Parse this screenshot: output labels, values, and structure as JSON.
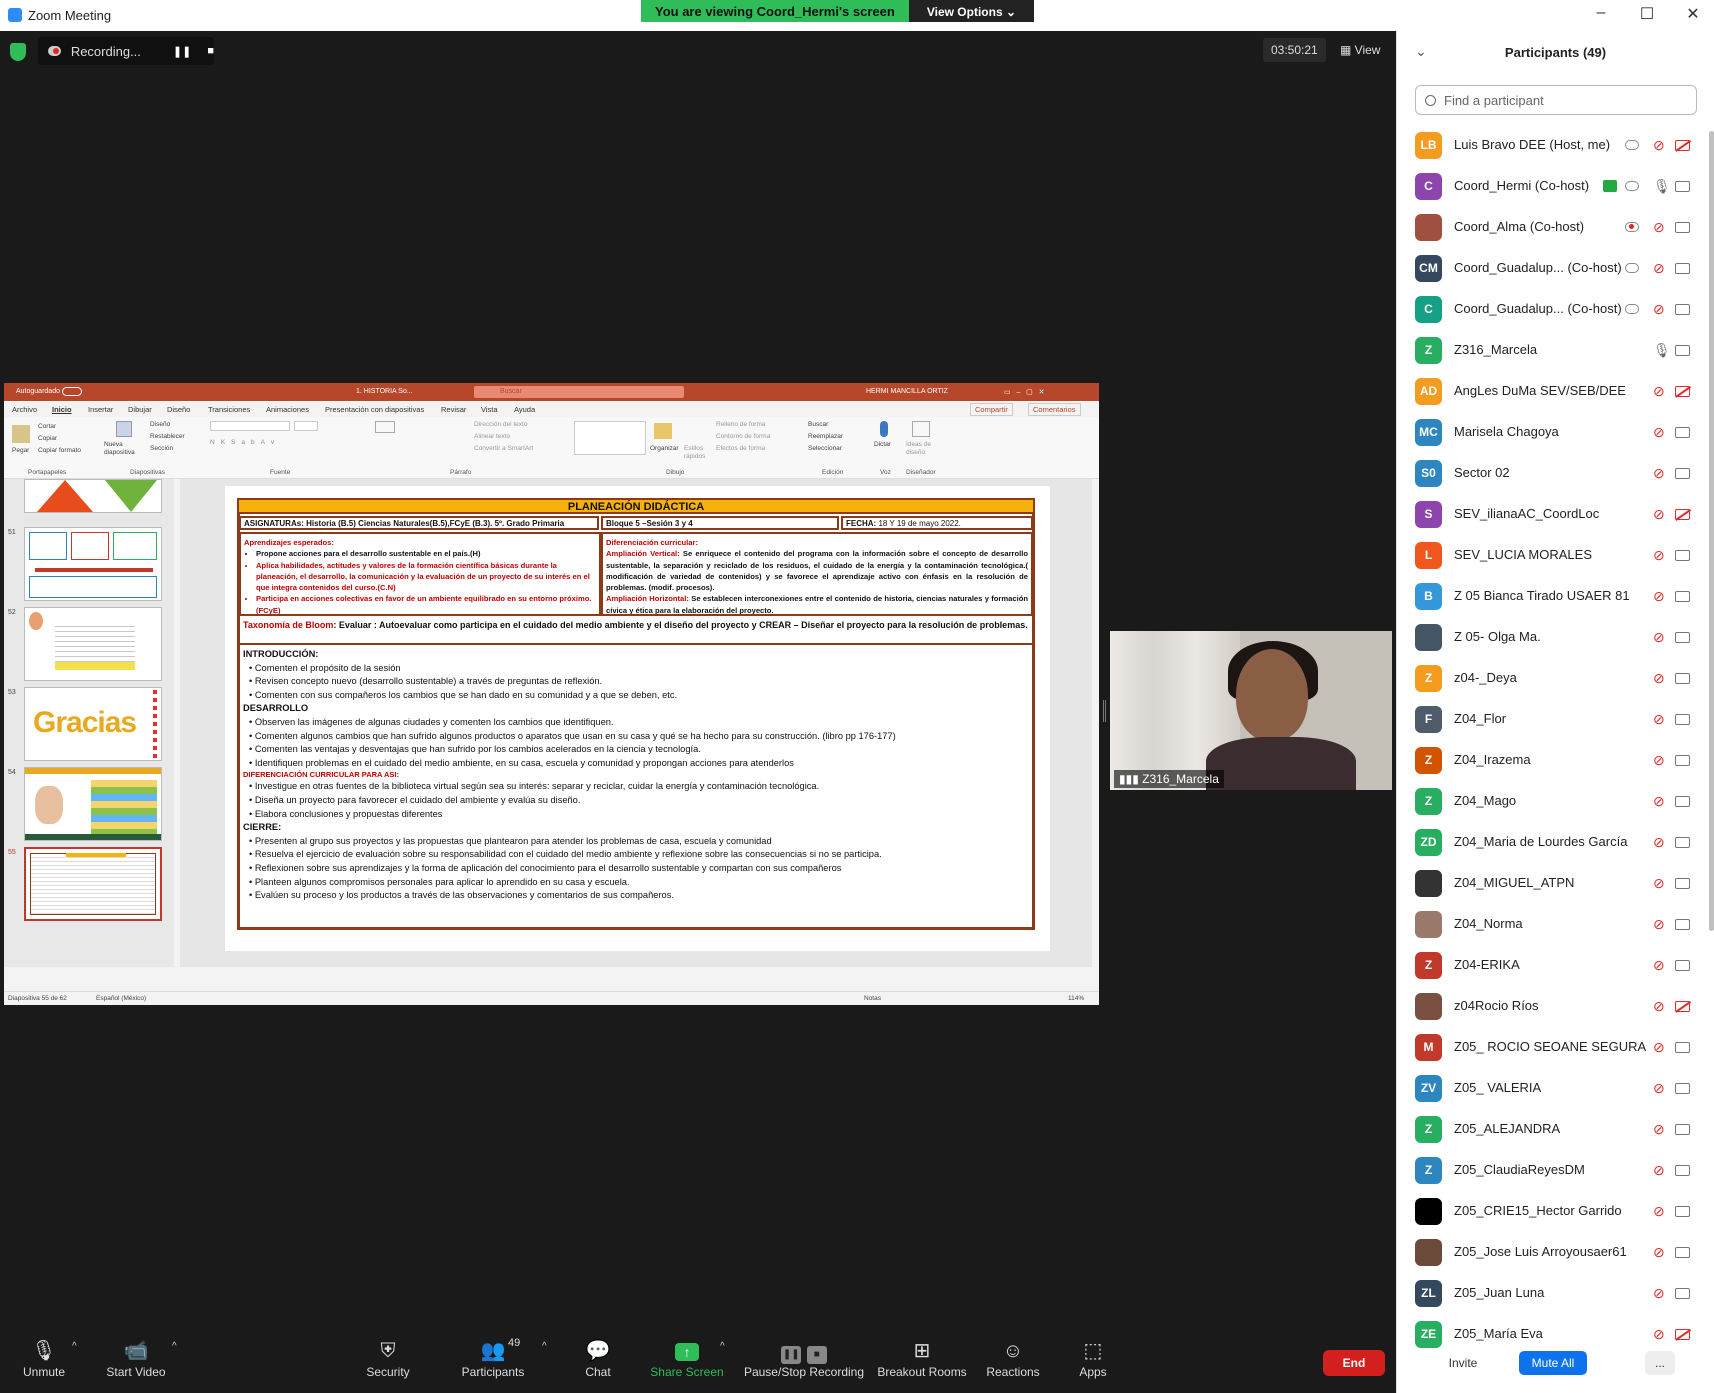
{
  "window": {
    "title": "Zoom Meeting"
  },
  "banner": {
    "viewing": "You are viewing Coord_Hermi's screen",
    "view_options": "View Options ⌄"
  },
  "meeting": {
    "recording_label": "Recording...",
    "timer": "03:50:21",
    "view_label": "View"
  },
  "ppt": {
    "autosave": "Autoguardado",
    "doc_title": "1. HISTORIA So...",
    "search": "Buscar",
    "user": "HERMI MANCILLA ORTIZ",
    "menu": [
      "Archivo",
      "Inicio",
      "Insertar",
      "Dibujar",
      "Diseño",
      "Transiciones",
      "Animaciones",
      "Presentación con diapositivas",
      "Revisar",
      "Vista",
      "Ayuda"
    ],
    "share": "Compartir",
    "comments": "Comentarios",
    "ribbon_groups": [
      "Portapapeles",
      "Diapositivas",
      "Fuente",
      "Párrafo",
      "Dibujo",
      "Edición",
      "Voz",
      "Diseñador"
    ],
    "ribbon_items": {
      "pegar": "Pegar",
      "cortar": "Cortar",
      "copiar": "Copiar",
      "copiar_formato": "Copiar formato",
      "nueva": "Nueva diapositiva",
      "diseno": "Diseño",
      "restablecer": "Restablecer",
      "seccion": "Sección",
      "buscar": "Buscar",
      "reemplazar": "Reemplazar",
      "seleccionar": "Seleccionar",
      "dictar": "Dictar",
      "ideas": "Ideas de diseño",
      "organizar": "Organizar",
      "estilos": "Estilos rápidos",
      "relleno": "Relleno de forma",
      "contorno": "Contorno de forma",
      "efectos": "Efectos de forma",
      "direccion": "Dirección del texto",
      "alinear": "Alinear texto",
      "smartart": "Convertir a SmartArt"
    },
    "thumb_numbers": [
      "51",
      "52",
      "53",
      "54",
      "55"
    ],
    "thumb53_text": "Gracias",
    "status": {
      "slide": "Diapositiva 55 de 62",
      "lang": "Español (México)",
      "notes": "Notas",
      "zoom": "114%"
    }
  },
  "slide": {
    "title": "PLANEACIÓN DIDÁCTICA",
    "asignaturas": "ASIGNATURAs: Historia (B.5)  Ciencias Naturales(B.5),FCyE (B.3). 5º. Grado Primaria",
    "bloque": "Bloque 5 –Sesión 3 y 4",
    "fecha_label": "FECHA:",
    "fecha": "18 Y 19 de mayo 2022.",
    "aprendizajes_title": "Aprendizajes esperados:",
    "aprendizajes": [
      "Propone acciones para el desarrollo sustentable en el país.(H)",
      "Aplica habilidades, actitudes y valores de la formación científica básicas durante la planeación, el desarrollo, la comunicación y la evaluación de un proyecto de su interés en el que integra contenidos del curso.(C.N)",
      "Participa en acciones colectivas en favor de un ambiente equilibrado en su entorno próximo.(FCyE)"
    ],
    "diferenciacion_title": "Diferenciación curricular:",
    "amp_vertical_label": "Ampliación Vertical:",
    "amp_vertical": "Se enriquece el contenido del programa con la información sobre el concepto de desarrollo sustentable, la separación y reciclado de los residuos, el cuidado de la energía y la contaminación tecnológica.( modificación de variedad de contenidos) y se favorece el aprendizaje activo con énfasis en la resolución de problemas. (modif. procesos).",
    "amp_horizontal_label": "Ampliación Horizontal:",
    "amp_horizontal": "Se establecen interconexiones entre el contenido de historia, ciencias naturales y formación cívica y ética para la elaboración del proyecto.",
    "bloom_label": "Taxonomía de Bloom",
    "bloom_text": ": Evaluar : Autoevaluar como participa en el cuidado del medio ambiente y el diseño del proyecto y CREAR – Diseñar el proyecto para la resolución de problemas.",
    "intro_title": "INTRODUCCIÓN:",
    "intro": [
      "Comenten el propósito de la sesión",
      "Revisen concepto nuevo (desarrollo sustentable) a través de preguntas de reflexión.",
      "Comenten con sus  compañeros los cambios que se han dado en su comunidad y a que se deben, etc."
    ],
    "desarrollo_title": "DESARROLLO",
    "desarrollo": [
      "Observen las imágenes de algunas ciudades y comenten los cambios que identifiquen.",
      "Comenten algunos cambios que han sufrido algunos productos o aparatos que usan en su casa y qué se ha hecho para su construcción. (libro pp 176-177)",
      "Comenten las ventajas y desventajas que han sufrido por los cambios acelerados en la ciencia y tecnología.",
      "Identifiquen problemas en el cuidado del medio ambiente, en su casa, escuela y comunidad y propongan acciones para atenderlos"
    ],
    "dif_asi": "DIFERENCIACIÓN CURRICULAR PARA ASI:",
    "asi": [
      "Investigue en otras fuentes de la biblioteca virtual según sea su interés: separar y reciclar, cuidar la energía y contaminación tecnológica.",
      "Diseña un proyecto para favorecer el cuidado del ambiente y evalúa su diseño.",
      "Elabora conclusiones y propuestas diferentes"
    ],
    "cierre_title": "CIERRE:",
    "cierre": [
      "Presenten al grupo sus proyectos y las propuestas que plantearon para atender los problemas de casa, escuela y comunidad",
      "Resuelva el ejercicio de evaluación sobre su responsabilidad con el cuidado del medio ambiente  y reflexione sobre las consecuencias si no se participa.",
      "Reflexionen sobre sus aprendizajes y la forma de aplicación del conocimiento para el desarrollo sustentable y compartan con sus compañeros",
      "Planteen algunos compromisos personales para aplicar lo aprendido en su casa y escuela.",
      "Evalúen su proceso y los productos a través de las observaciones y comentarios de sus compañeros."
    ]
  },
  "video": {
    "name": "Z316_Marcela"
  },
  "participants": {
    "title": "Participants (49)",
    "search_placeholder": "Find a participant",
    "items": [
      {
        "initials": "LB",
        "color": "#f39c1f",
        "name": "Luis Bravo DEE (Host, me)",
        "mic": "off",
        "cam": "off",
        "rec": "grey"
      },
      {
        "initials": "C",
        "color": "#8e44ad",
        "name": "Coord_Hermi (Co-host)",
        "mic": "on",
        "cam": "on",
        "rec": "grey",
        "share": true
      },
      {
        "initials": "",
        "color": "#a05040",
        "name": "Coord_Alma (Co-host)",
        "mic": "off",
        "cam": "on",
        "rec": "red"
      },
      {
        "initials": "CM",
        "color": "#34495e",
        "name": "Coord_Guadalup...  (Co-host)",
        "mic": "off",
        "cam": "on",
        "rec": "grey"
      },
      {
        "initials": "C",
        "color": "#16a085",
        "name": "Coord_Guadalup...  (Co-host)",
        "mic": "off",
        "cam": "on",
        "rec": "grey"
      },
      {
        "initials": "Z",
        "color": "#27ae60",
        "name": "Z316_Marcela",
        "mic": "on",
        "cam": "on"
      },
      {
        "initials": "AD",
        "color": "#f39c1f",
        "name": "AngLes DuMa SEV/SEB/DEE",
        "mic": "off",
        "cam": "off"
      },
      {
        "initials": "MC",
        "color": "#2e86c1",
        "name": "Marisela Chagoya",
        "mic": "off",
        "cam": "on"
      },
      {
        "initials": "S0",
        "color": "#2e86c1",
        "name": "Sector 02",
        "mic": "off",
        "cam": "on"
      },
      {
        "initials": "S",
        "color": "#8e44ad",
        "name": "SEV_ilianaAC_CoordLoc",
        "mic": "off",
        "cam": "off"
      },
      {
        "initials": "L",
        "color": "#f0561d",
        "name": "SEV_LUCIA MORALES",
        "mic": "off",
        "cam": "on"
      },
      {
        "initials": "B",
        "color": "#3498db",
        "name": "Z 05 Bianca Tirado USAER 81",
        "mic": "off",
        "cam": "on"
      },
      {
        "initials": "",
        "color": "#445566",
        "name": "Z 05- Olga Ma.",
        "mic": "off",
        "cam": "on"
      },
      {
        "initials": "Z",
        "color": "#f39c1f",
        "name": "z04-_Deya",
        "mic": "off",
        "cam": "on"
      },
      {
        "initials": "F",
        "color": "#4d5b6a",
        "name": "Z04_Flor",
        "mic": "off",
        "cam": "on"
      },
      {
        "initials": "Z",
        "color": "#d35400",
        "name": "Z04_Irazema",
        "mic": "off",
        "cam": "on"
      },
      {
        "initials": "Z",
        "color": "#27ae60",
        "name": "Z04_Mago",
        "mic": "off",
        "cam": "on"
      },
      {
        "initials": "ZD",
        "color": "#27ae60",
        "name": "Z04_Maria de Lourdes García",
        "mic": "off",
        "cam": "on"
      },
      {
        "initials": "",
        "color": "#333333",
        "name": "Z04_MIGUEL_ATPN",
        "mic": "off",
        "cam": "on"
      },
      {
        "initials": "",
        "color": "#9a7b6b",
        "name": "Z04_Norma",
        "mic": "off",
        "cam": "on"
      },
      {
        "initials": "Z",
        "color": "#c0392b",
        "name": "Z04-ERIKA",
        "mic": "off",
        "cam": "on"
      },
      {
        "initials": "",
        "color": "#7a5040",
        "name": "z04Rocio Ríos",
        "mic": "off",
        "cam": "off"
      },
      {
        "initials": "M",
        "color": "#c0392b",
        "name": "Z05_ ROCIO SEOANE SEGURA",
        "mic": "off",
        "cam": "on"
      },
      {
        "initials": "ZV",
        "color": "#2e86c1",
        "name": "Z05_ VALERIA",
        "mic": "off",
        "cam": "on"
      },
      {
        "initials": "Z",
        "color": "#27ae60",
        "name": "Z05_ALEJANDRA",
        "mic": "off",
        "cam": "on"
      },
      {
        "initials": "Z",
        "color": "#2e86c1",
        "name": "Z05_ClaudiaReyesDM",
        "mic": "off",
        "cam": "on"
      },
      {
        "initials": "",
        "color": "#000000",
        "name": "Z05_CRIE15_Hector Garrido",
        "mic": "off",
        "cam": "on"
      },
      {
        "initials": "",
        "color": "#6b4a3a",
        "name": "Z05_Jose Luis Arroyousaer61",
        "mic": "off",
        "cam": "on"
      },
      {
        "initials": "ZL",
        "color": "#34495e",
        "name": "Z05_Juan Luna",
        "mic": "off",
        "cam": "on"
      },
      {
        "initials": "ZE",
        "color": "#27ae60",
        "name": "Z05_María Eva",
        "mic": "off",
        "cam": "off"
      }
    ],
    "invite": "Invite",
    "mute_all": "Mute All",
    "more": "..."
  },
  "toolbar": {
    "unmute": "Unmute",
    "start_video": "Start Video",
    "security": "Security",
    "participants": "Participants",
    "participants_count": "49",
    "chat": "Chat",
    "share_screen": "Share Screen",
    "pause_stop": "Pause/Stop Recording",
    "breakout": "Breakout Rooms",
    "reactions": "Reactions",
    "apps": "Apps",
    "end": "End"
  }
}
